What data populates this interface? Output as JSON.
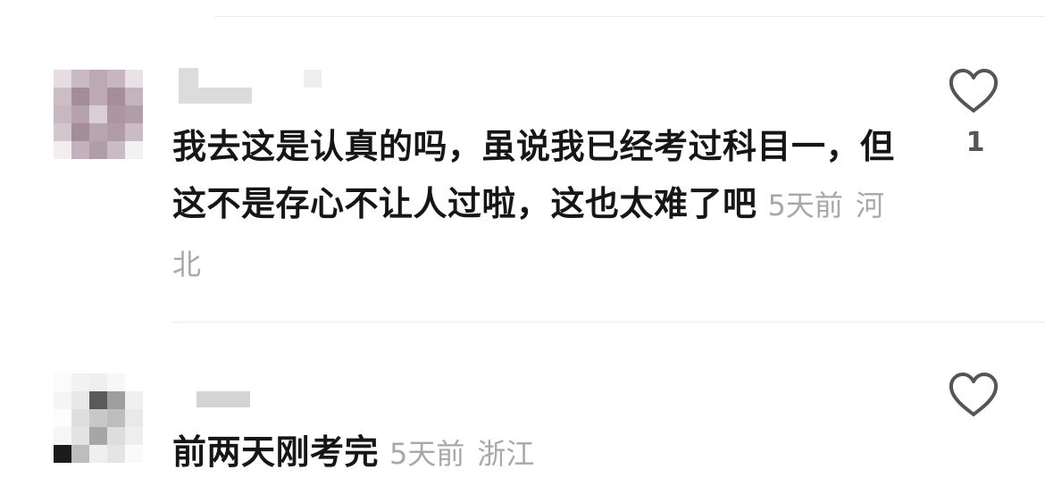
{
  "comments": [
    {
      "text": "我去这是认真的吗，虽说我已经考过科目一，但这不是存心不让人过啦，这也太难了吧",
      "time": "5天前",
      "location": "河北",
      "like_count": "1",
      "like_icon": "heart-outline-icon"
    },
    {
      "text": "前两天刚考完",
      "time": "5天前",
      "location": "浙江",
      "like_count": "",
      "like_icon": "heart-outline-icon"
    }
  ],
  "colors": {
    "text": "#161616",
    "meta": "#a8a8a8",
    "icon": "#555555",
    "divider": "#ececec"
  }
}
